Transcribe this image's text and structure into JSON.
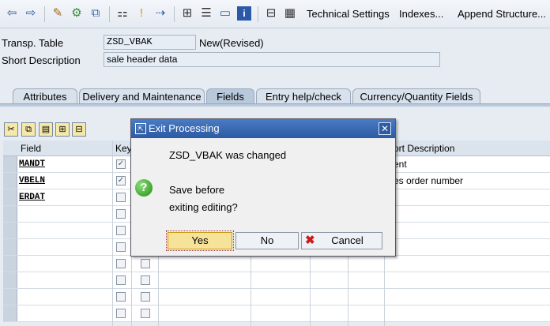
{
  "toolbar": {
    "technical_settings": "Technical Settings",
    "indexes": "Indexes...",
    "append_structure": "Append Structure..."
  },
  "header": {
    "transp_table_label": "Transp. Table",
    "table_name": "ZSD_VBAK",
    "status": "New(Revised)",
    "short_desc_label": "Short Description",
    "short_desc_value": "sale header data"
  },
  "tabs": [
    {
      "label": "Attributes"
    },
    {
      "label": "Delivery and Maintenance"
    },
    {
      "label": "Fields"
    },
    {
      "label": "Entry help/check"
    },
    {
      "label": "Currency/Quantity Fields"
    }
  ],
  "table": {
    "col_field": "Field",
    "col_key": "Key",
    "col_short_desc": "ort Description",
    "rows": [
      {
        "field": "MANDT",
        "desc": "ent"
      },
      {
        "field": "VBELN",
        "desc": "es order number"
      },
      {
        "field": "ERDAT",
        "desc": ""
      }
    ]
  },
  "dialog": {
    "title": "Exit Processing",
    "message": "ZSD_VBAK was changed",
    "question_line1": "Save before",
    "question_line2": "exiting editing?",
    "yes": "Yes",
    "no": "No",
    "cancel": "Cancel"
  },
  "colors": {
    "title_bar": "#2c5aa3",
    "yes_button": "#f7e29a",
    "cancel_icon": "#cc1b1b",
    "question_icon": "#2a9a1e"
  }
}
